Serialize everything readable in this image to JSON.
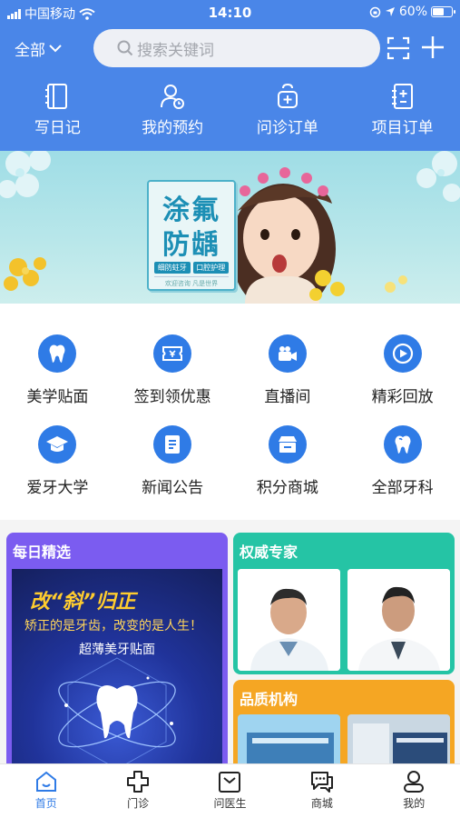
{
  "status_bar": {
    "carrier": "中国移动",
    "time": "14:10",
    "battery": "60%",
    "battery_level": 0.6
  },
  "header": {
    "city": "全部",
    "search_placeholder": "搜索关键词",
    "quick_actions": [
      {
        "label": "写日记",
        "icon": "diary-icon"
      },
      {
        "label": "我的预约",
        "icon": "appointment-icon"
      },
      {
        "label": "问诊订单",
        "icon": "consult-order-icon"
      },
      {
        "label": "项目订单",
        "icon": "project-order-icon"
      }
    ]
  },
  "banner": {
    "title_line1": "涂氟",
    "title_line2": "防龋",
    "tag1": "细防蛀牙",
    "tag2": "口腔护理",
    "footer": "欢迎咨询   凡是世界"
  },
  "services": [
    {
      "label": "美学贴面",
      "icon": "tooth-icon"
    },
    {
      "label": "签到领优惠",
      "icon": "coupon-icon"
    },
    {
      "label": "直播间",
      "icon": "live-camera-icon"
    },
    {
      "label": "精彩回放",
      "icon": "replay-icon"
    },
    {
      "label": "爱牙大学",
      "icon": "graduation-cap-icon"
    },
    {
      "label": "新闻公告",
      "icon": "news-icon"
    },
    {
      "label": "积分商城",
      "icon": "points-mall-icon"
    },
    {
      "label": "全部牙科",
      "icon": "all-dental-icon"
    }
  ],
  "cards": {
    "daily": {
      "title": "每日精选",
      "poster_headline": "改“斜”归正",
      "poster_sub": "矫正的是牙齿，改变的是人生！",
      "poster_tag": "超薄美牙贴面"
    },
    "expert": {
      "title": "权威专家"
    },
    "org": {
      "title": "品质机构"
    }
  },
  "tabbar": [
    {
      "label": "首页",
      "icon": "home-icon",
      "active": true
    },
    {
      "label": "门诊",
      "icon": "clinic-icon",
      "active": false
    },
    {
      "label": "问医生",
      "icon": "ask-doctor-icon",
      "active": false
    },
    {
      "label": "商城",
      "icon": "mall-icon",
      "active": false
    },
    {
      "label": "我的",
      "icon": "profile-icon",
      "active": false
    }
  ],
  "colors": {
    "header_blue": "#4a86e8",
    "accent_blue": "#2f7be6",
    "purple": "#7b5cf0",
    "teal": "#25c4a5",
    "orange": "#f5a623"
  }
}
